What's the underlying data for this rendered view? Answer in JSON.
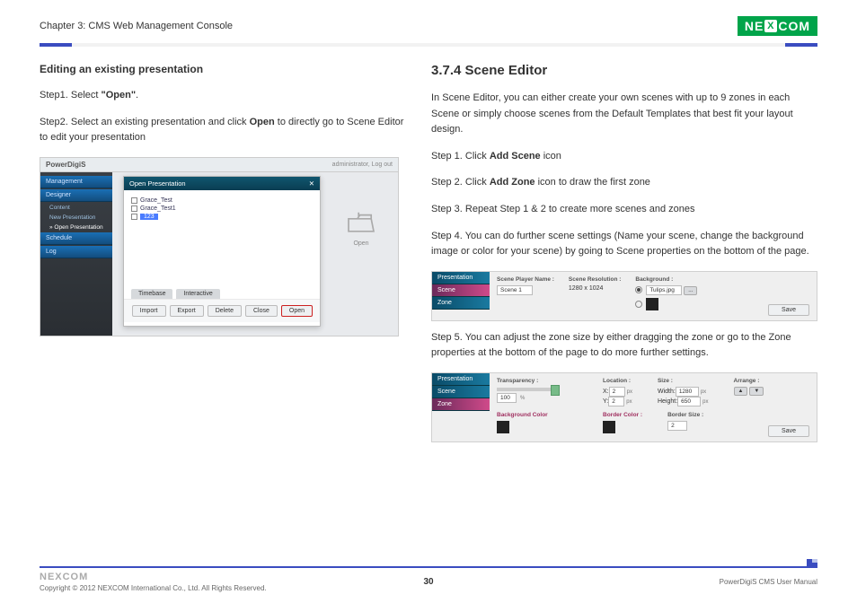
{
  "header": {
    "chapter": "Chapter 3: CMS Web Management Console",
    "logo_left": "NE",
    "logo_x": "X",
    "logo_right": "COM"
  },
  "left": {
    "subhead": "Editing an existing presentation",
    "step1_pre": "Step1. Select ",
    "step1_bold": "\"Open\"",
    "step1_post": ".",
    "step2_pre": "Step2. Select an existing presentation and click ",
    "step2_bold": "Open",
    "step2_post": " to directly go to Scene Editor to edit your presentation",
    "shot": {
      "brand": "PowerDigiS",
      "user": "administrator,  Log out",
      "side": {
        "items": [
          "Management",
          "Designer",
          "Schedule",
          "Log"
        ],
        "subs": [
          "Content",
          "New Presentation",
          "» Open Presentation"
        ]
      },
      "dialog": {
        "title": "Open Presentation",
        "files": [
          "Grace_Test",
          "Grace_Test1",
          "123"
        ],
        "tabs": [
          "Timebase",
          "Interactive"
        ],
        "buttons": [
          "Import",
          "Export",
          "Delete",
          "Close",
          "Open"
        ]
      },
      "open_label": "Open"
    }
  },
  "right": {
    "section": "3.7.4 Scene Editor",
    "intro": "In Scene Editor, you can either create your own scenes with up to 9 zones in each Scene or simply choose scenes from the Default Templates that best fit your layout design.",
    "step1_pre": "Step 1. Click ",
    "step1_bold": "Add Scene",
    "step1_post": " icon",
    "step2_pre": "Step 2. Click ",
    "step2_bold": "Add Zone",
    "step2_post": " icon to draw the first zone",
    "step3": "Step 3. Repeat Step 1 & 2 to create more scenes and zones",
    "step4": "Step 4. You can do further scene settings (Name your scene, change the background image or color for your scene) by going to Scene properties on the bottom of the page.",
    "step5": "Step 5. You can adjust the zone size by either dragging the zone or go to the Zone properties at the bottom of the page to do more further settings.",
    "panel_side": [
      "Presentation",
      "Scene",
      "Zone"
    ],
    "panel1": {
      "name_label": "Scene Player Name :",
      "name_value": "Scene 1",
      "res_label": "Scene Resolution :",
      "res_value": "1280 x 1024",
      "bg_label": "Background :",
      "bg_value": "Tulips.jpg",
      "save": "Save"
    },
    "panel2": {
      "trans_label": "Transparency :",
      "trans_value": "100",
      "trans_unit": "%",
      "loc_label": "Location :",
      "loc_x_label": "X:",
      "loc_x": "2",
      "loc_y_label": "Y:",
      "loc_y": "2",
      "size_label": "Size :",
      "size_w_label": "Width:",
      "size_w": "1280",
      "size_h_label": "Height:",
      "size_h": "650",
      "unit_px": "px",
      "arrange_label": "Arrange :",
      "bgc_label": "Background Color",
      "bc_label": "Border Color :",
      "bs_label": "Border Size :",
      "bs_value": "2",
      "save": "Save"
    }
  },
  "footer": {
    "logo": "NEXCOM",
    "copyright": "Copyright © 2012 NEXCOM International Co., Ltd. All Rights Reserved.",
    "page": "30",
    "manual": "PowerDigiS CMS User Manual"
  }
}
